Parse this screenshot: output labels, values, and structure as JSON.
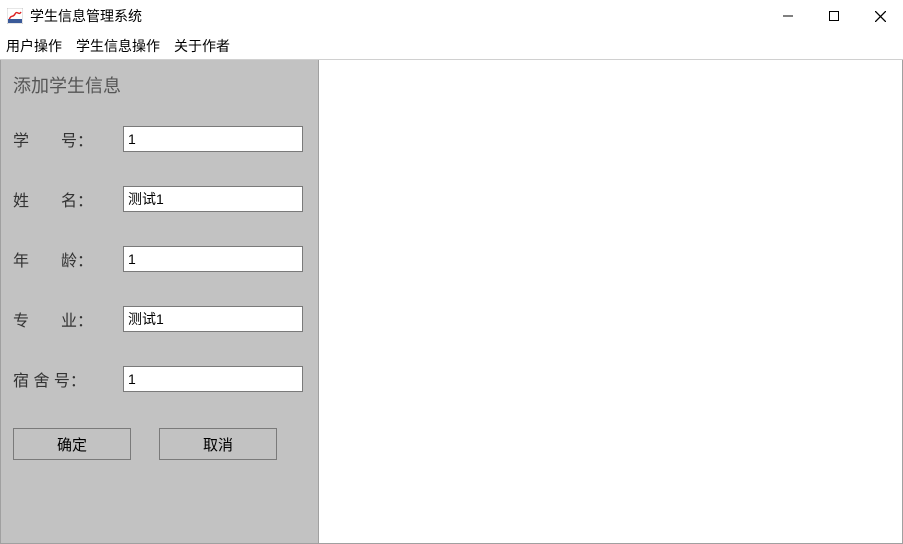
{
  "window": {
    "title": "学生信息管理系统"
  },
  "menubar": {
    "items": [
      "用户操作",
      "学生信息操作",
      "关于作者"
    ]
  },
  "form": {
    "title": "添加学生信息",
    "fields": {
      "student_id": {
        "label": "学　　号：",
        "value": "1"
      },
      "name": {
        "label": "姓　　名：",
        "value": "测试1"
      },
      "age": {
        "label": "年　　龄：",
        "value": "1"
      },
      "major": {
        "label": "专　　业：",
        "value": "测试1"
      },
      "dorm": {
        "label": "宿 舍 号：",
        "value": "1"
      }
    },
    "buttons": {
      "ok": "确定",
      "cancel": "取消"
    }
  }
}
